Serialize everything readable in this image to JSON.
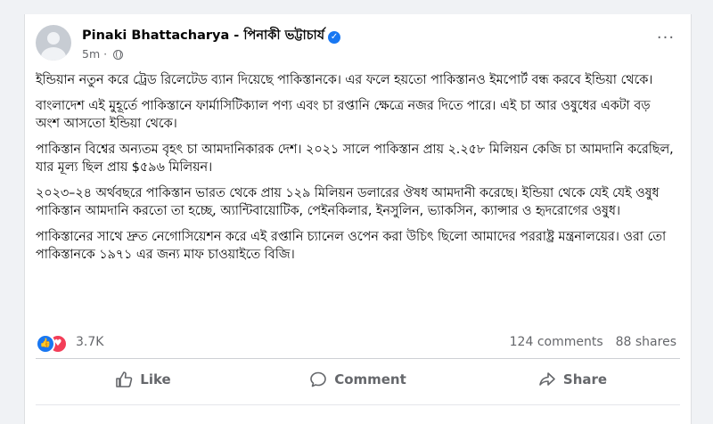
{
  "post": {
    "author": "Pinaki Bhattacharya - পিনাকী ভট্টাচার্য",
    "time": "5m",
    "more_label": "···",
    "paragraphs": [
      "ইন্ডিয়ান নতুন করে ট্রেড রিলেটেড ব্যান দিয়েছে পাকিস্তানকে। এর ফলে হয়তো পাকিস্তানও ইমপোর্ট বন্ধ করবে ইন্ডিয়া থেকে।",
      "বাংলাদেশ এই মুহূর্তে পাকিস্তানে ফার্মাসিটিক্যাল পণ্য এবং চা রপ্তানি ক্ষেত্রে নজর দিতে পারে। এই চা আর ওষুধের একটা বড় অংশ আসতো ইন্ডিয়া থেকে।",
      "পাকিস্তান বিশ্বের অন্যতম বৃহৎ চা আমদানিকারক দেশ।  ২০২১ সালে পাকিস্তান প্রায় ২.২৫৮ মিলিয়ন কেজি চা আমদানি করেছিল, যার মূল্য ছিল প্রায় $৫৯৬ মিলিয়ন।",
      "২০২৩–২৪ অর্থবছরে পাকিস্তান ভারত থেকে প্রায় ১২৯ মিলিয়ন ডলারের ঔষধ আমদানী করেছে। ইন্ডিয়া থেকে যেই যেই ওষুধ পাকিস্তান আমদানি করতো তা হচ্ছে, অ্যান্টিবায়োটিক, পেইনকিলার, ইনসুলিন, ভ্যাকসিন, ক্যান্সার ও হৃদরোগের ওষুধ।",
      "পাকিস্তানের সাথে দ্রুত নেগোসিয়েশন করে এই রপ্তানি চ্যানেল ওপেন করা উচিৎ ছিলো আমাদের পররাষ্ট্র মন্ত্রনালয়ের। ওরা তো পাকিস্তানকে ১৯৭১ এর জন্য মাফ চাওয়াইতে বিজি।"
    ]
  },
  "stats": {
    "reaction_count": "3.7K",
    "comments": "124 comments",
    "shares": "88 shares"
  },
  "actions": {
    "like": "Like",
    "comment": "Comment",
    "share": "Share"
  },
  "colors": {
    "accent": "#1877f2",
    "love": "#f33e58",
    "muted": "#65676b"
  },
  "icons": {
    "like_reaction": "thumbs-up-icon",
    "love_reaction": "heart-icon",
    "globe": "globe-icon",
    "verified": "verified-badge-icon"
  }
}
